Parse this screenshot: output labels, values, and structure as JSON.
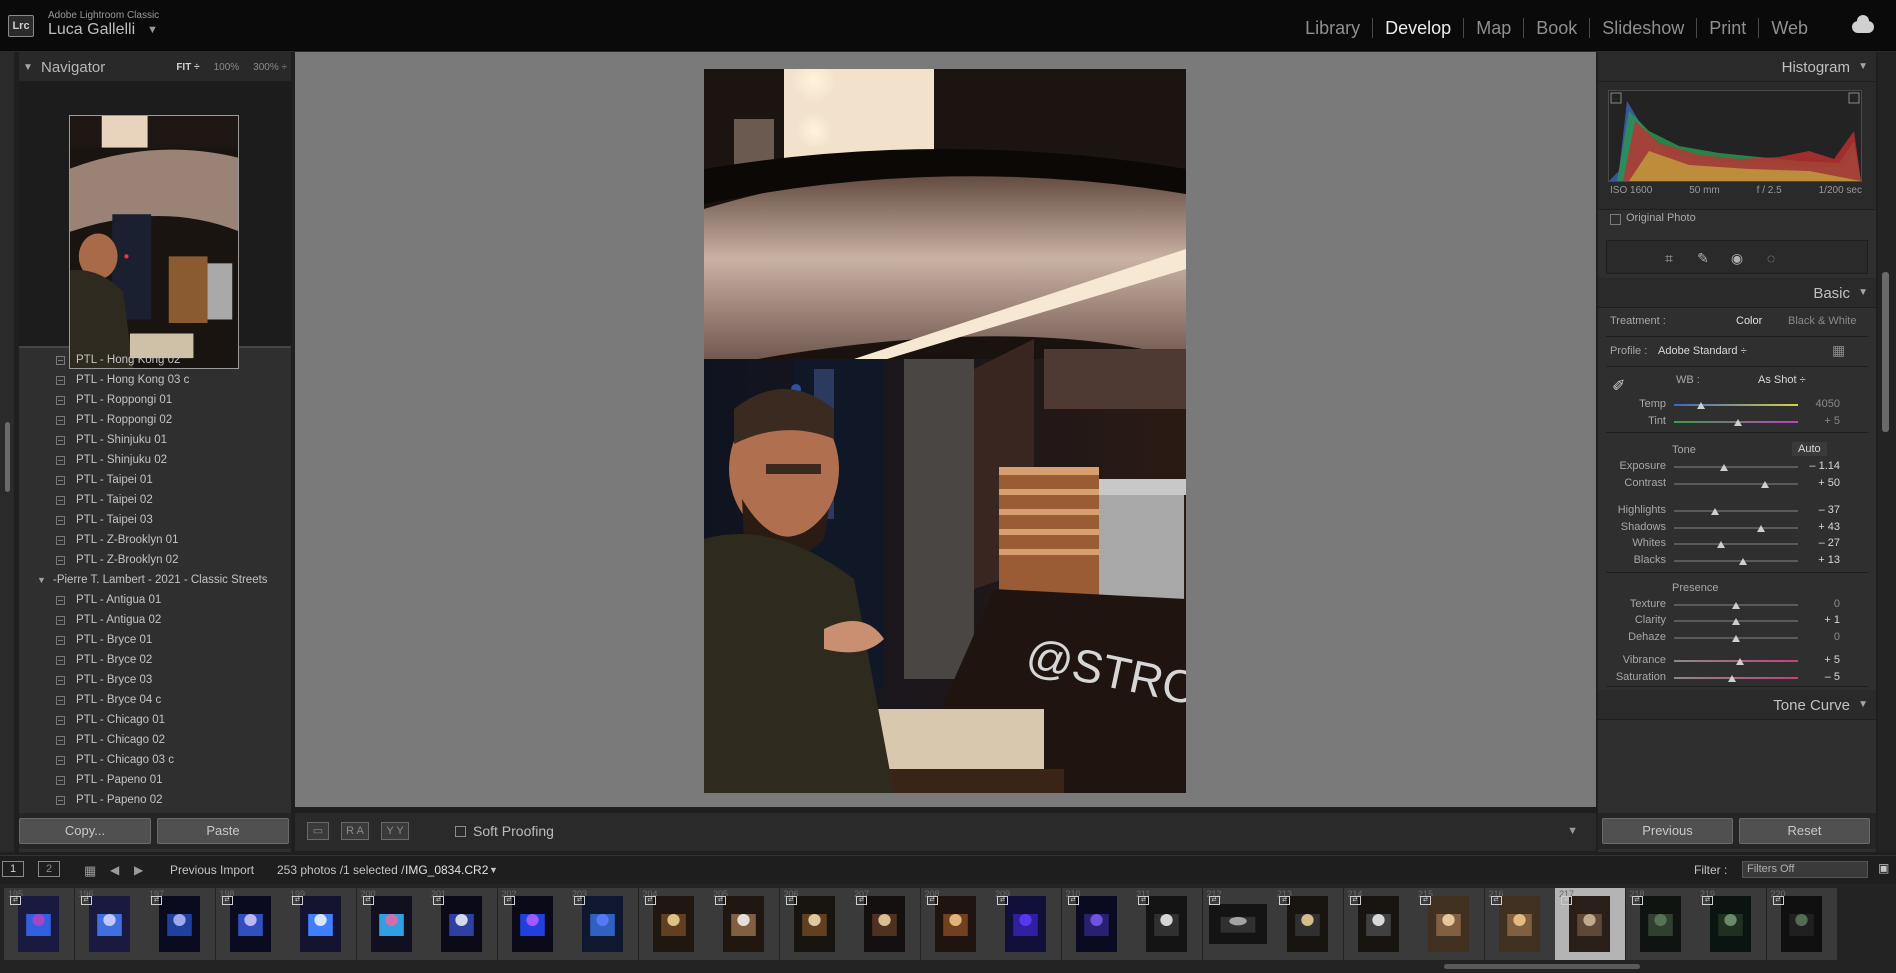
{
  "app": {
    "product_name": "Adobe Lightroom Classic",
    "logo_text": "Lrc",
    "user_name": "Luca Gallelli"
  },
  "modules": [
    "Library",
    "Develop",
    "Map",
    "Book",
    "Slideshow",
    "Print",
    "Web"
  ],
  "active_module": "Develop",
  "navigator": {
    "title": "Navigator",
    "zoom_options": [
      "FIT ÷",
      "100%",
      "300% ÷"
    ]
  },
  "presets": [
    {
      "type": "preset",
      "label": "PTL - Hong Kong 02"
    },
    {
      "type": "preset",
      "label": "PTL - Hong Kong 03 c"
    },
    {
      "type": "preset",
      "label": "PTL - Roppongi 01"
    },
    {
      "type": "preset",
      "label": "PTL - Roppongi 02"
    },
    {
      "type": "preset",
      "label": "PTL - Shinjuku 01"
    },
    {
      "type": "preset",
      "label": "PTL - Shinjuku 02"
    },
    {
      "type": "preset",
      "label": "PTL - Taipei 01"
    },
    {
      "type": "preset",
      "label": "PTL - Taipei 02"
    },
    {
      "type": "preset",
      "label": "PTL - Taipei 03"
    },
    {
      "type": "preset",
      "label": "PTL - Z-Brooklyn 01"
    },
    {
      "type": "preset",
      "label": "PTL - Z-Brooklyn 02"
    },
    {
      "type": "group",
      "label": "-Pierre T. Lambert - 2021 - Classic Streets"
    },
    {
      "type": "preset",
      "label": "PTL - Antigua 01"
    },
    {
      "type": "preset",
      "label": "PTL - Antigua 02"
    },
    {
      "type": "preset",
      "label": "PTL - Bryce 01"
    },
    {
      "type": "preset",
      "label": "PTL - Bryce 02"
    },
    {
      "type": "preset",
      "label": "PTL - Bryce 03"
    },
    {
      "type": "preset",
      "label": "PTL - Bryce 04 c"
    },
    {
      "type": "preset",
      "label": "PTL - Chicago 01"
    },
    {
      "type": "preset",
      "label": "PTL - Chicago 02"
    },
    {
      "type": "preset",
      "label": "PTL - Chicago 03 c"
    },
    {
      "type": "preset",
      "label": "PTL - Papeno 01"
    },
    {
      "type": "preset",
      "label": "PTL - Papeno 02"
    }
  ],
  "left_buttons": {
    "copy": "Copy...",
    "paste": "Paste"
  },
  "toolbar": {
    "soft_proofing": "Soft Proofing",
    "ra": "R A",
    "yy": "Y Y"
  },
  "histogram": {
    "title": "Histogram",
    "iso": "ISO 1600",
    "focal": "50 mm",
    "aperture": "f / 2.5",
    "shutter": "1/200 sec",
    "original_photo": "Original Photo"
  },
  "basic": {
    "title": "Basic",
    "treatment_label": "Treatment :",
    "treatment_options": [
      "Color",
      "Black & White"
    ],
    "treatment_selected": "Color",
    "profile_label": "Profile :",
    "profile_value": "Adobe Standard ÷",
    "wb_label": "WB :",
    "wb_value": "As Shot ÷",
    "tone_label": "Tone",
    "auto_label": "Auto",
    "presence_label": "Presence",
    "sliders": [
      {
        "group": "wb",
        "label": "Temp",
        "value": "4050",
        "pos": 0.22,
        "dim": true
      },
      {
        "group": "wb",
        "label": "Tint",
        "value": "+ 5",
        "pos": 0.52,
        "dim": true
      },
      {
        "group": "tone",
        "label": "Exposure",
        "value": "– 1.14",
        "pos": 0.4
      },
      {
        "group": "tone",
        "label": "Contrast",
        "value": "+ 50",
        "pos": 0.73
      },
      {
        "group": "tone",
        "label": "Highlights",
        "value": "– 37",
        "pos": 0.33
      },
      {
        "group": "tone",
        "label": "Shadows",
        "value": "+ 43",
        "pos": 0.7
      },
      {
        "group": "tone",
        "label": "Whites",
        "value": "– 27",
        "pos": 0.38
      },
      {
        "group": "tone",
        "label": "Blacks",
        "value": "+ 13",
        "pos": 0.56
      },
      {
        "group": "presence",
        "label": "Texture",
        "value": "0",
        "pos": 0.5,
        "dim": true
      },
      {
        "group": "presence",
        "label": "Clarity",
        "value": "+ 1",
        "pos": 0.5
      },
      {
        "group": "presence",
        "label": "Dehaze",
        "value": "0",
        "pos": 0.5,
        "dim": true
      },
      {
        "group": "presence",
        "label": "Vibrance",
        "value": "+ 5",
        "pos": 0.53
      },
      {
        "group": "presence",
        "label": "Saturation",
        "value": "– 5",
        "pos": 0.47
      }
    ]
  },
  "tone_curve": {
    "title": "Tone Curve"
  },
  "right_buttons": {
    "previous": "Previous",
    "reset": "Reset"
  },
  "filmbar": {
    "screen1": "1",
    "screen2": "2",
    "source": "Previous Import",
    "count": "253 photos /1 selected /",
    "filename": "IMG_0834.CR2",
    "filter_label": "Filter :",
    "filter_value": "Filters Off"
  },
  "filmstrip": {
    "numbers": [
      "195",
      "196",
      "197",
      "198",
      "199",
      "200",
      "201",
      "202",
      "203",
      "204",
      "205",
      "206",
      "207",
      "208",
      "209",
      "210",
      "211",
      "212",
      "213",
      "214",
      "215",
      "216",
      "217",
      "218",
      "219",
      "220"
    ],
    "selected": "217"
  },
  "colors": {
    "accent_active": "#ececec",
    "panel_bg": "#2f2f2f",
    "work_bg": "#7a7a7a"
  }
}
